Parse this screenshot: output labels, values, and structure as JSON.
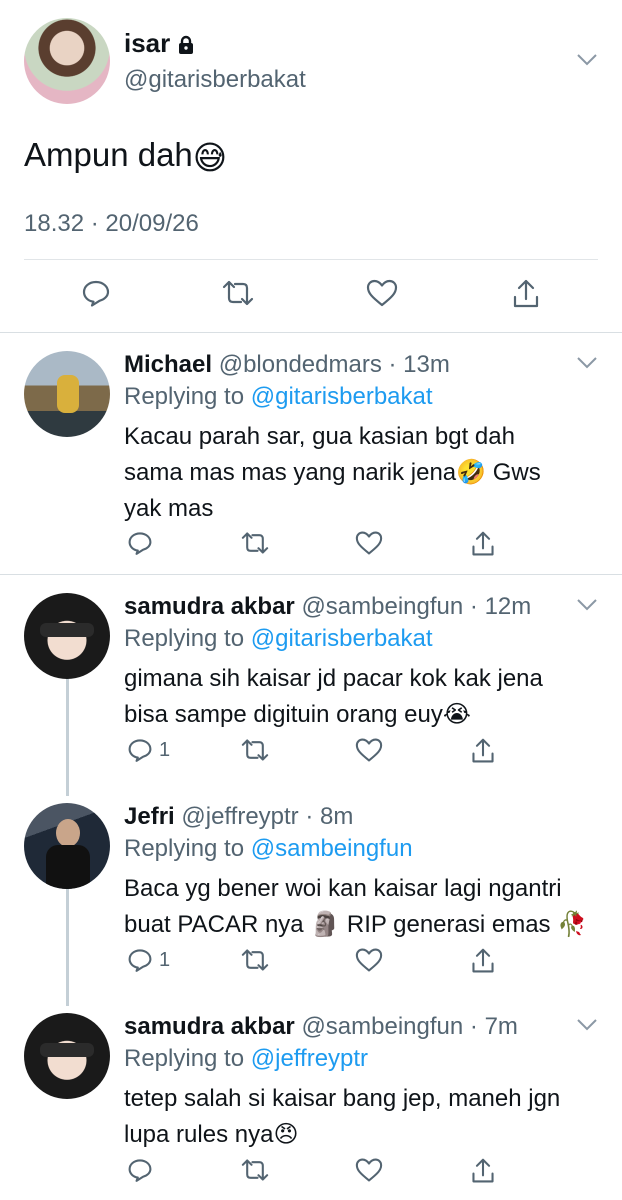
{
  "main_tweet": {
    "name": "isar",
    "handle": "@gitarisberbakat",
    "text": "Ampun dah",
    "emoji": "😅",
    "timestamp": "18.32 · 20/09/26"
  },
  "replies": [
    {
      "name": "Michael",
      "handle": "@blondedmars",
      "time": "13m",
      "replying_label": "Replying to",
      "replying_to": "@gitarisberbakat",
      "line1": "Kacau parah sar, gua kasian bgt dah",
      "line2_a": "sama mas mas yang narik jena",
      "emoji_a": "🤣",
      "line2_b": " Gws",
      "line3": "yak mas",
      "reply_count": ""
    },
    {
      "name": "samudra akbar",
      "handle": "@sambeingfun",
      "time": "12m",
      "replying_label": "Replying to",
      "replying_to": "@gitarisberbakat",
      "line1": "gimana sih kaisar jd pacar kok kak jena",
      "line2_a": "bisa sampe digituin orang euy",
      "emoji_a": "😭",
      "reply_count": "1"
    },
    {
      "name": "Jefri",
      "handle": "@jeffreyptr",
      "time": "8m",
      "replying_label": "Replying to",
      "replying_to": "@sambeingfun",
      "line1": "Baca yg bener woi kan kaisar lagi ngantri",
      "line2_a": "buat PACAR nya ",
      "emoji_a": "🗿",
      "line2_b": " RIP generasi emas ",
      "emoji_b": "🥀",
      "reply_count": "1"
    },
    {
      "name": "samudra akbar",
      "handle": "@sambeingfun",
      "time": "7m",
      "replying_label": "Replying to",
      "replying_to": "@jeffreyptr",
      "line1": "tetep salah si kaisar bang jep, maneh jgn",
      "line2_a": "lupa rules nya",
      "emoji_a": "😠",
      "reply_count": ""
    }
  ],
  "meta_separator": " · ",
  "colors": {
    "text": "#0f1419",
    "muted": "#536471",
    "accent": "#1d9bf0",
    "divider": "#e1e5e8"
  },
  "icons": [
    "lock-icon",
    "chevron-down-icon",
    "reply-icon",
    "retweet-icon",
    "like-icon",
    "share-icon"
  ]
}
